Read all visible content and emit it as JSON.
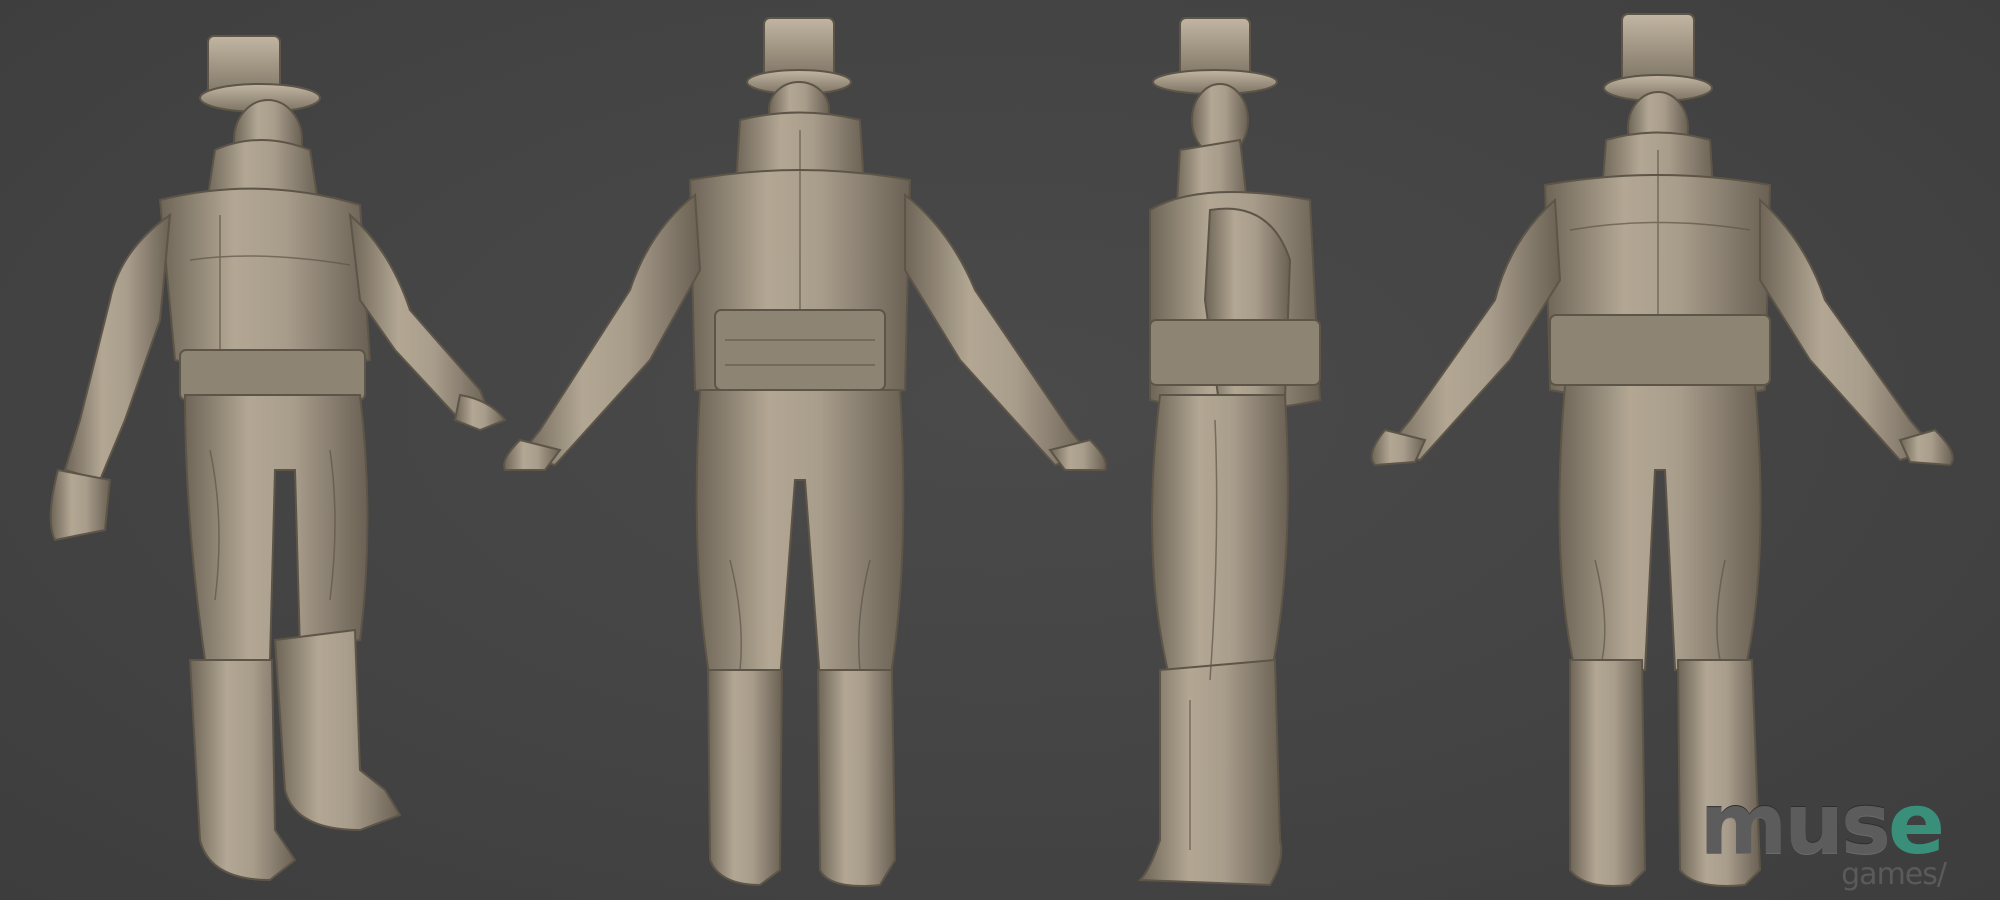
{
  "scene": {
    "description_colors": {
      "background": "#434343",
      "clay": "#a89c8b",
      "clay_shadow": "#6e6557",
      "clay_highlight": "#cfc3b0"
    },
    "views": [
      {
        "view": "front-three-quarter"
      },
      {
        "view": "back"
      },
      {
        "view": "side"
      },
      {
        "view": "front"
      }
    ]
  },
  "logo": {
    "word_main": "mus",
    "word_accent": "e",
    "word_sub": "games/",
    "accent_color": "#3a8f7a"
  }
}
